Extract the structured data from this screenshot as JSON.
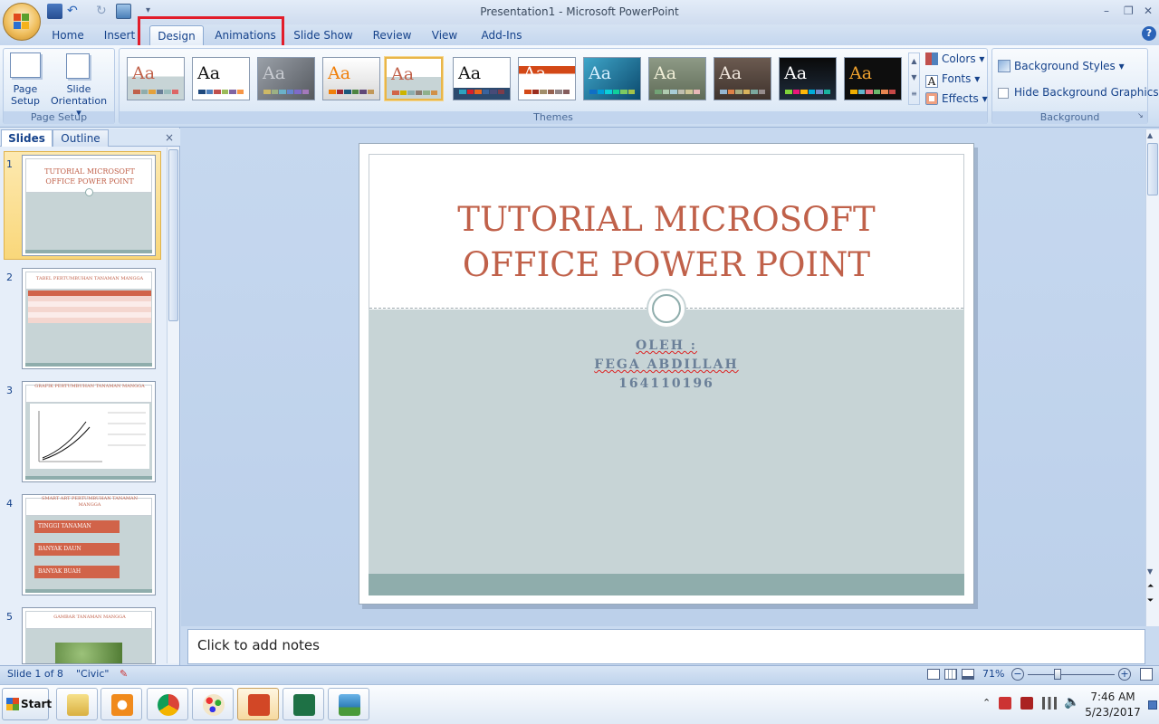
{
  "window": {
    "title": "Presentation1 - Microsoft PowerPoint",
    "minimize": "–",
    "restore": "❐",
    "close": "✕"
  },
  "tabs": [
    "Home",
    "Insert",
    "Design",
    "Animations",
    "Slide Show",
    "Review",
    "View",
    "Add-Ins"
  ],
  "help_label": "?",
  "ribbon": {
    "page_setup": {
      "page_setup_label_1": "Page",
      "page_setup_label_2": "Setup",
      "orientation_label_1": "Slide",
      "orientation_label_2": "Orientation ▾",
      "group_label": "Page Setup"
    },
    "themes": {
      "group_label": "Themes",
      "sample_text": "Aa"
    },
    "theme_side": {
      "colors": "Colors ▾",
      "fonts": "Fonts ▾",
      "effects": "Effects ▾"
    },
    "background": {
      "styles": "Background Styles ▾",
      "hide_graphics": "Hide Background Graphics",
      "group_label": "Background"
    }
  },
  "left_pane": {
    "tab_slides": "Slides",
    "tab_outline": "Outline",
    "close": "×",
    "thumbnails": [
      {
        "num": "1",
        "title": "TUTORIAL MICROSOFT OFFICE POWER POINT"
      },
      {
        "num": "2",
        "title": "TABEL PERTUMBUHAN TANAMAN MANGGA"
      },
      {
        "num": "3",
        "title": "GRAFIK PERTUMBUHAN TANAMAN MANGGA"
      },
      {
        "num": "4",
        "title": "SMART ART PERTUMBUHAN TANAMAN MANGGA",
        "items": [
          "TINGGI TANAMAN",
          "BANYAK DAUN",
          "BANYAK BUAH"
        ]
      },
      {
        "num": "5",
        "title": "GAMBAR TANAMAN MANGGA"
      }
    ]
  },
  "slide": {
    "title_line1": "TUTORIAL MICROSOFT",
    "title_line2": "OFFICE POWER POINT",
    "sub_line1": "OLEH :",
    "sub_line2": "FEGA ABDILLAH",
    "sub_line3": "164110196"
  },
  "notes_placeholder": "Click to add notes",
  "status": {
    "slide_count": "Slide 1 of 8",
    "theme_name": "\"Civic\"",
    "zoom": "71%",
    "zoom_out": "−",
    "zoom_in": "+"
  },
  "taskbar": {
    "start": "Start",
    "time": "7:46 AM",
    "date": "5/23/2017"
  },
  "colors": {
    "accent_title": "#c0614a",
    "slide_body": "#c7d4d6",
    "slide_footer": "#8fadac",
    "highlight_box": "#e21c2a"
  }
}
